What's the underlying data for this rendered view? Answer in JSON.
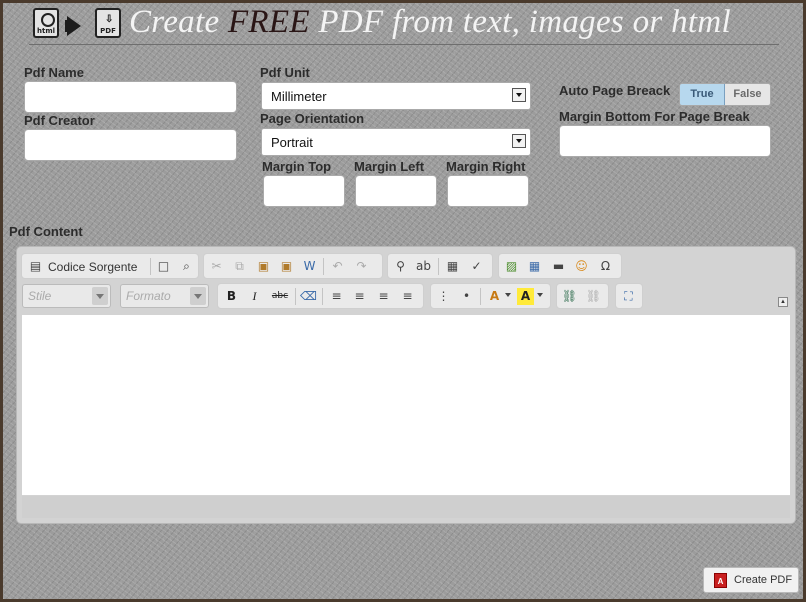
{
  "header": {
    "icon_left_label": "html",
    "icon_right_label": "PDF",
    "title_prefix": "Create ",
    "title_highlight": "FREE",
    "title_suffix": " PDF from text, images or html"
  },
  "form": {
    "pdf_name_label": "Pdf Name",
    "pdf_creator_label": "Pdf Creator",
    "pdf_unit_label": "Pdf Unit",
    "pdf_unit_value": "Millimeter",
    "page_orientation_label": "Page Orientation",
    "page_orientation_value": "Portrait",
    "margin_top_label": "Margin Top",
    "margin_left_label": "Margin Left",
    "margin_right_label": "Margin Right",
    "auto_page_break_label": "Auto Page Breack",
    "auto_page_break_true": "True",
    "auto_page_break_false": "False",
    "margin_bottom_label": "Margin Bottom For Page Break",
    "pdf_content_label": "Pdf Content"
  },
  "editor": {
    "source_button": "Codice Sorgente",
    "style_placeholder": "Stile",
    "format_placeholder": "Formato",
    "bold": "B",
    "italic": "I",
    "strike": "abc"
  },
  "actions": {
    "create_pdf": "Create PDF",
    "pdf_icon_text": "A"
  }
}
